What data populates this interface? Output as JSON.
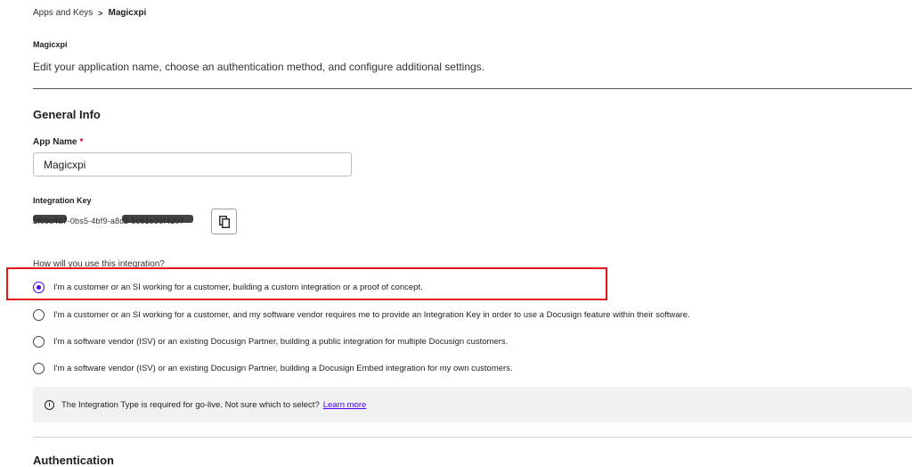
{
  "breadcrumb": {
    "parent": "Apps and Keys",
    "separator": ">",
    "current": "Magicxpi"
  },
  "app": {
    "name": "Magicxpi",
    "description": "Edit your application name, choose an authentication method, and configure additional settings."
  },
  "general_info": {
    "title": "General Info",
    "app_name_label": "App Name",
    "required_marker": "*",
    "app_name_value": "Magicxpi",
    "integration_key_label": "Integration Key",
    "integration_key_value": "2f09c4a7-0bs5-4bf9-a8c2-5c61e36f4207",
    "copy_icon": "copy-icon"
  },
  "integration_usage": {
    "question": "How will you use this integration?",
    "selected_index": 0,
    "options": [
      "I'm a customer or an SI working for a customer, building a custom integration or a proof of concept.",
      "I'm a customer or an SI working for a customer, and my software vendor requires me to provide an Integration Key in order to use a Docusign feature within their software.",
      "I'm a software vendor (ISV) or an existing Docusign Partner, building a public integration for multiple Docusign customers.",
      "I'm a software vendor (ISV) or an existing Docusign Partner, building a Docusign Embed integration for my own customers."
    ]
  },
  "info_banner": {
    "icon": "info-icon",
    "text": "The Integration Type is required for go-live. Not sure which to select?",
    "link": "Learn more"
  },
  "authentication": {
    "title": "Authentication"
  },
  "colors": {
    "accent": "#4c00ff",
    "highlight": "#e3131e",
    "required": "#d6002b"
  }
}
